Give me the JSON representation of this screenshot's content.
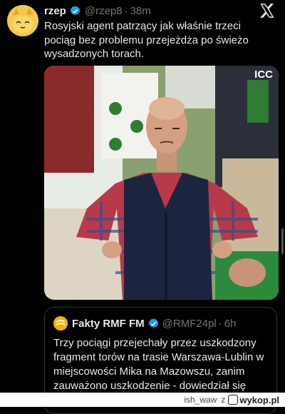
{
  "tweet": {
    "display_name": "rzep",
    "handle": "@rzep8",
    "separator": "·",
    "time": "38m",
    "text": "Rosyjski agent patrzący jak właśnie trzeci pociąg bez problemu przejeżdża po świeżo wysadzonych torach.",
    "media_watermark": "ICC"
  },
  "quote": {
    "display_name": "Fakty RMF FM",
    "handle": "@RMF24pl",
    "separator": "·",
    "time": "6h",
    "text": "Trzy pociągi przejechały przez uszkodzony fragment torów na trasie Warszawa-Lublin w miejscowości Mika na Mazowszu, zanim zauważono uszkodzenie - dowiedział się"
  },
  "footer": {
    "author": "ish_waw",
    "joiner": "z",
    "site": "wykop.pl"
  },
  "colors": {
    "background": "#000000",
    "text": "#e7e9ea",
    "muted": "#71767b",
    "verified": "#1d9bf0",
    "quote_border": "#2f3336"
  },
  "icons": [
    "avatar-cat",
    "verified-badge-icon",
    "close-x-icon",
    "wykop-logo-icon"
  ]
}
